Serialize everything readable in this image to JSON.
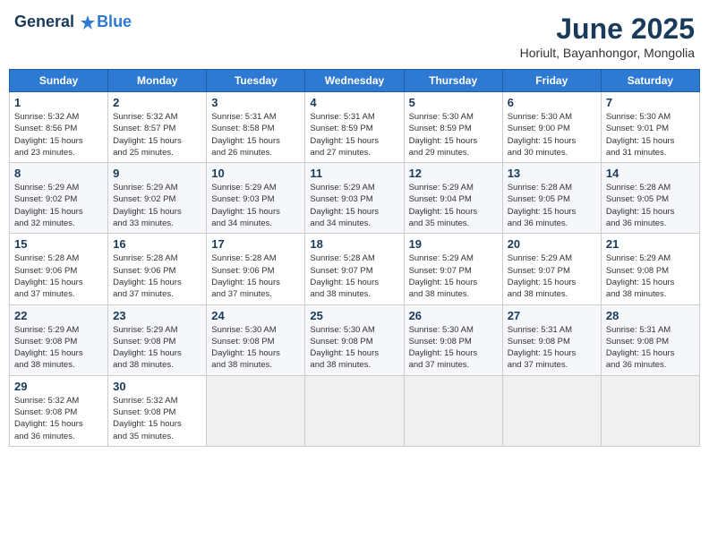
{
  "header": {
    "logo_general": "General",
    "logo_blue": "Blue",
    "main_title": "June 2025",
    "subtitle": "Horiult, Bayanhongor, Mongolia"
  },
  "columns": [
    "Sunday",
    "Monday",
    "Tuesday",
    "Wednesday",
    "Thursday",
    "Friday",
    "Saturday"
  ],
  "weeks": [
    {
      "days": [
        {
          "num": "1",
          "sunrise": "5:32 AM",
          "sunset": "8:56 PM",
          "daylight": "15 hours and 23 minutes."
        },
        {
          "num": "2",
          "sunrise": "5:32 AM",
          "sunset": "8:57 PM",
          "daylight": "15 hours and 25 minutes."
        },
        {
          "num": "3",
          "sunrise": "5:31 AM",
          "sunset": "8:58 PM",
          "daylight": "15 hours and 26 minutes."
        },
        {
          "num": "4",
          "sunrise": "5:31 AM",
          "sunset": "8:59 PM",
          "daylight": "15 hours and 27 minutes."
        },
        {
          "num": "5",
          "sunrise": "5:30 AM",
          "sunset": "8:59 PM",
          "daylight": "15 hours and 29 minutes."
        },
        {
          "num": "6",
          "sunrise": "5:30 AM",
          "sunset": "9:00 PM",
          "daylight": "15 hours and 30 minutes."
        },
        {
          "num": "7",
          "sunrise": "5:30 AM",
          "sunset": "9:01 PM",
          "daylight": "15 hours and 31 minutes."
        }
      ]
    },
    {
      "days": [
        {
          "num": "8",
          "sunrise": "5:29 AM",
          "sunset": "9:02 PM",
          "daylight": "15 hours and 32 minutes."
        },
        {
          "num": "9",
          "sunrise": "5:29 AM",
          "sunset": "9:02 PM",
          "daylight": "15 hours and 33 minutes."
        },
        {
          "num": "10",
          "sunrise": "5:29 AM",
          "sunset": "9:03 PM",
          "daylight": "15 hours and 34 minutes."
        },
        {
          "num": "11",
          "sunrise": "5:29 AM",
          "sunset": "9:03 PM",
          "daylight": "15 hours and 34 minutes."
        },
        {
          "num": "12",
          "sunrise": "5:29 AM",
          "sunset": "9:04 PM",
          "daylight": "15 hours and 35 minutes."
        },
        {
          "num": "13",
          "sunrise": "5:28 AM",
          "sunset": "9:05 PM",
          "daylight": "15 hours and 36 minutes."
        },
        {
          "num": "14",
          "sunrise": "5:28 AM",
          "sunset": "9:05 PM",
          "daylight": "15 hours and 36 minutes."
        }
      ]
    },
    {
      "days": [
        {
          "num": "15",
          "sunrise": "5:28 AM",
          "sunset": "9:06 PM",
          "daylight": "15 hours and 37 minutes."
        },
        {
          "num": "16",
          "sunrise": "5:28 AM",
          "sunset": "9:06 PM",
          "daylight": "15 hours and 37 minutes."
        },
        {
          "num": "17",
          "sunrise": "5:28 AM",
          "sunset": "9:06 PM",
          "daylight": "15 hours and 37 minutes."
        },
        {
          "num": "18",
          "sunrise": "5:28 AM",
          "sunset": "9:07 PM",
          "daylight": "15 hours and 38 minutes."
        },
        {
          "num": "19",
          "sunrise": "5:29 AM",
          "sunset": "9:07 PM",
          "daylight": "15 hours and 38 minutes."
        },
        {
          "num": "20",
          "sunrise": "5:29 AM",
          "sunset": "9:07 PM",
          "daylight": "15 hours and 38 minutes."
        },
        {
          "num": "21",
          "sunrise": "5:29 AM",
          "sunset": "9:08 PM",
          "daylight": "15 hours and 38 minutes."
        }
      ]
    },
    {
      "days": [
        {
          "num": "22",
          "sunrise": "5:29 AM",
          "sunset": "9:08 PM",
          "daylight": "15 hours and 38 minutes."
        },
        {
          "num": "23",
          "sunrise": "5:29 AM",
          "sunset": "9:08 PM",
          "daylight": "15 hours and 38 minutes."
        },
        {
          "num": "24",
          "sunrise": "5:30 AM",
          "sunset": "9:08 PM",
          "daylight": "15 hours and 38 minutes."
        },
        {
          "num": "25",
          "sunrise": "5:30 AM",
          "sunset": "9:08 PM",
          "daylight": "15 hours and 38 minutes."
        },
        {
          "num": "26",
          "sunrise": "5:30 AM",
          "sunset": "9:08 PM",
          "daylight": "15 hours and 37 minutes."
        },
        {
          "num": "27",
          "sunrise": "5:31 AM",
          "sunset": "9:08 PM",
          "daylight": "15 hours and 37 minutes."
        },
        {
          "num": "28",
          "sunrise": "5:31 AM",
          "sunset": "9:08 PM",
          "daylight": "15 hours and 36 minutes."
        }
      ]
    },
    {
      "days": [
        {
          "num": "29",
          "sunrise": "5:32 AM",
          "sunset": "9:08 PM",
          "daylight": "15 hours and 36 minutes."
        },
        {
          "num": "30",
          "sunrise": "5:32 AM",
          "sunset": "9:08 PM",
          "daylight": "15 hours and 35 minutes."
        },
        null,
        null,
        null,
        null,
        null
      ]
    }
  ],
  "labels": {
    "sunrise": "Sunrise:",
    "sunset": "Sunset:",
    "daylight": "Daylight:"
  }
}
